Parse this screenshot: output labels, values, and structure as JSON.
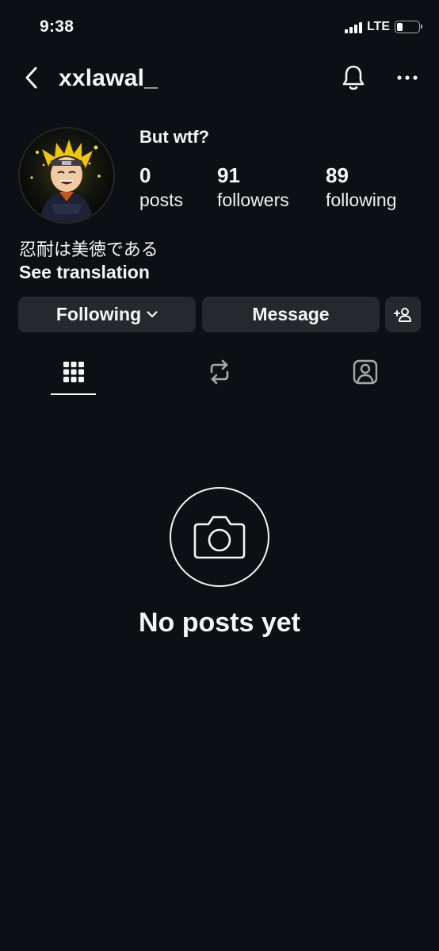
{
  "status_bar": {
    "time": "9:38",
    "network": "LTE"
  },
  "header": {
    "username": "xxlawal_"
  },
  "profile": {
    "display_name": "But wtf?",
    "stats": [
      {
        "value": "0",
        "label": "posts"
      },
      {
        "value": "91",
        "label": "followers"
      },
      {
        "value": "89",
        "label": "following"
      }
    ],
    "bio": "忍耐は美徳である",
    "see_translation": "See translation"
  },
  "actions": {
    "following_label": "Following",
    "message_label": "Message"
  },
  "tabs": [
    {
      "icon": "grid-icon",
      "active": true
    },
    {
      "icon": "reels-repost-icon",
      "active": false
    },
    {
      "icon": "tagged-person-icon",
      "active": false
    }
  ],
  "empty_state": {
    "title": "No posts yet",
    "icon": "camera-icon"
  },
  "colors": {
    "background": "#0c1014",
    "button": "#25292e",
    "text": "#f5f5f5"
  }
}
